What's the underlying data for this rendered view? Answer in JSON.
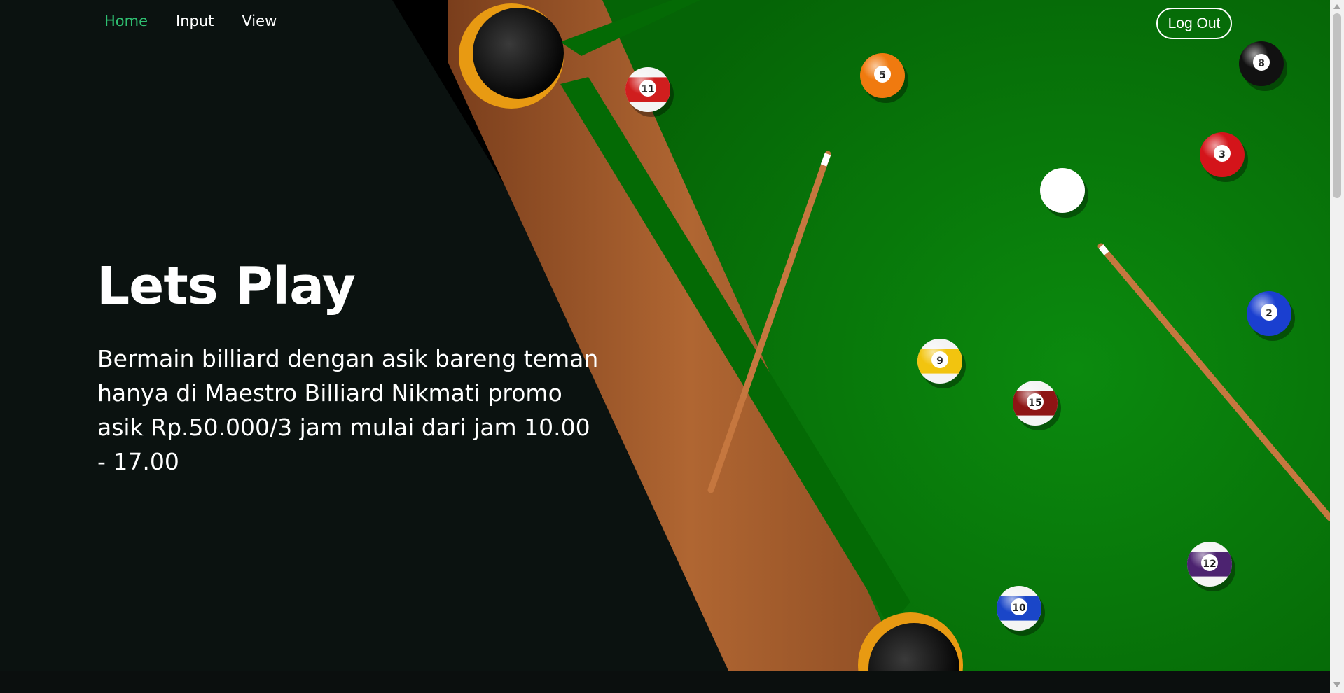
{
  "nav": {
    "items": [
      {
        "label": "Home",
        "active": true
      },
      {
        "label": "Input",
        "active": false
      },
      {
        "label": "View",
        "active": false
      }
    ],
    "logout_label": "Log Out"
  },
  "hero": {
    "title": "Lets Play",
    "description": "Bermain billiard dengan asik bareng teman hanya di Maestro Billiard Nikmati promo asik Rp.50.000/3 jam mulai dari jam 10.00 - 17.00"
  },
  "balls": [
    {
      "number": "11",
      "color": "#d01e1e",
      "striped": true
    },
    {
      "number": "5",
      "color": "#f07a0f",
      "striped": false
    },
    {
      "number": "8",
      "color": "#111111",
      "striped": false
    },
    {
      "number": "3",
      "color": "#d4141a",
      "striped": false
    },
    {
      "number": "",
      "color": "#ffffff",
      "striped": false
    },
    {
      "number": "2",
      "color": "#1a3fd0",
      "striped": false
    },
    {
      "number": "9",
      "color": "#f2c40f",
      "striped": true
    },
    {
      "number": "15",
      "color": "#8e1414",
      "striped": true
    },
    {
      "number": "12",
      "color": "#4c2370",
      "striped": true
    },
    {
      "number": "10",
      "color": "#1a46c8",
      "striped": true
    }
  ],
  "colors": {
    "accent": "#2fbf71",
    "felt": "#0a7a0c",
    "rail": "#9c5a2c",
    "background": "#0b1210"
  }
}
